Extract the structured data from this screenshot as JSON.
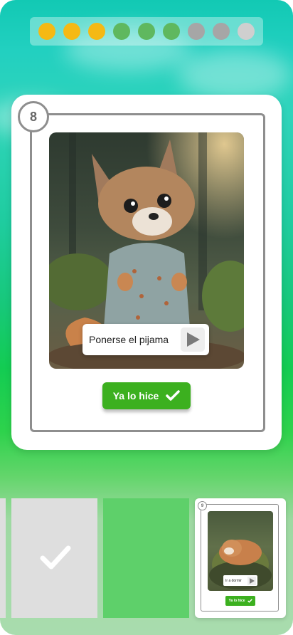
{
  "progress": {
    "dots": [
      {
        "state": "done",
        "color": "#f5b914"
      },
      {
        "state": "done",
        "color": "#f5b914"
      },
      {
        "state": "done",
        "color": "#f5b914"
      },
      {
        "state": "active",
        "color": "#5fb85f"
      },
      {
        "state": "active",
        "color": "#5fb85f"
      },
      {
        "state": "active",
        "color": "#5fb85f"
      },
      {
        "state": "pending",
        "color": "#a6a6a6"
      },
      {
        "state": "pending",
        "color": "#a6a6a6"
      },
      {
        "state": "pending",
        "color": "#cfcfcf"
      }
    ]
  },
  "current_card": {
    "number": "8",
    "activity_label": "Ponerse el pijama",
    "done_button_label": "Ya lo hice",
    "image_icon": "fox-in-pajamas-illustration",
    "play_icon": "play-icon",
    "check_icon": "check-icon"
  },
  "carousel": {
    "completed_icon": "check-icon",
    "next_card": {
      "number": "9",
      "activity_label": "Ir a dormir",
      "done_button_label": "Ya lo hice",
      "image_icon": "sleeping-fox-illustration"
    }
  },
  "colors": {
    "accent_green": "#3cb01f",
    "frame_gray": "#8e8e8e",
    "done_yellow": "#f5b914"
  }
}
